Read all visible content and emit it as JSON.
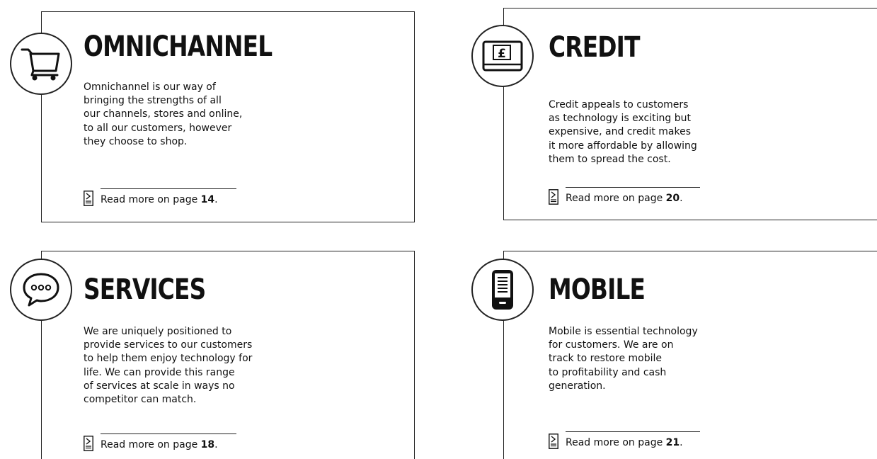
{
  "sections": {
    "omnichannel": {
      "title": "OMNICHANNEL",
      "body": "Omnichannel is our way of\nbringing the strengths of all\nour channels, stores and online,\nto all our customers, however\nthey choose to shop.",
      "read_more": "Read more on page ",
      "page": "14",
      "period": ".",
      "icon": "shopping-cart-icon"
    },
    "credit": {
      "title": "CREDIT",
      "body": "Credit appeals to customers\nas technology is exciting but\nexpensive, and credit makes\nit more affordable by allowing\nthem to spread the cost.",
      "read_more": "Read more on page ",
      "page": "20",
      "period": ".",
      "icon": "pound-card-icon"
    },
    "services": {
      "title": "SERVICES",
      "body": "We are uniquely positioned to\nprovide services to our customers\nto help them enjoy technology for\nlife. We can provide this range\nof services at scale in ways no\ncompetitor can match.",
      "read_more": "Read more on page ",
      "page": "18",
      "period": ".",
      "icon": "speech-bubble-icon"
    },
    "mobile": {
      "title": "MOBILE",
      "body": "Mobile is essential technology\nfor customers. We are on\ntrack to restore mobile\nto profitability and cash\ngeneration.",
      "read_more": "Read more on page ",
      "page": "21",
      "period": ".",
      "icon": "mobile-phone-icon"
    }
  }
}
